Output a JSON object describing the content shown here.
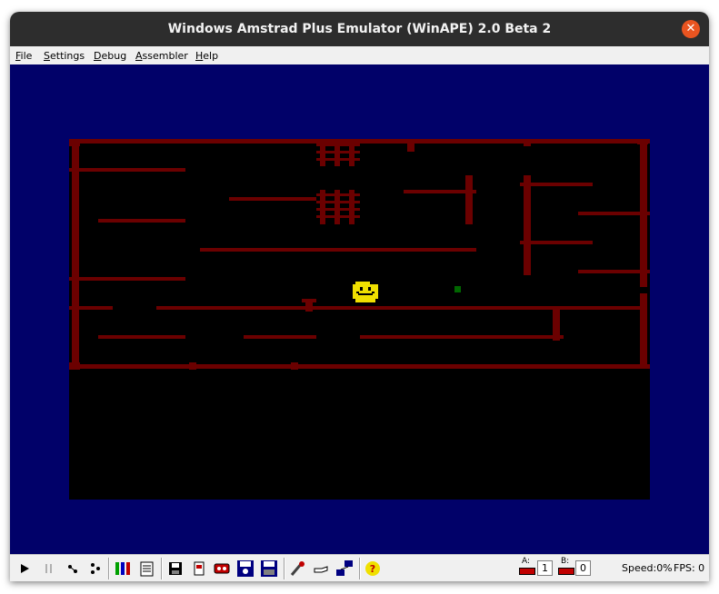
{
  "window": {
    "title": "Windows Amstrad Plus Emulator (WinAPE) 2.0 Beta 2",
    "close_icon": "close-icon"
  },
  "menu": [
    "File",
    "Settings",
    "Debug",
    "Assembler",
    "Help"
  ],
  "colors": {
    "screen_border": "#010169",
    "maze_wall": "#6b0000",
    "player": "#f0e000",
    "pickup": "#006600"
  },
  "toolbar": {
    "buttons": [
      "play-icon",
      "pause-icon",
      "step-icon",
      "step-over-icon",
      "memory-icon",
      "disassembly-icon",
      "save-icon",
      "snapshot-icon",
      "tape-icon",
      "disk-save-icon",
      "disk-save-all-icon",
      "tools-icon",
      "hand-icon",
      "network-icon",
      "help-icon"
    ],
    "drive_a": {
      "label": "A:",
      "value": "1"
    },
    "drive_b": {
      "label": "B:",
      "value": "0"
    },
    "speed": "Speed:0%",
    "fps": "FPS: 0"
  }
}
